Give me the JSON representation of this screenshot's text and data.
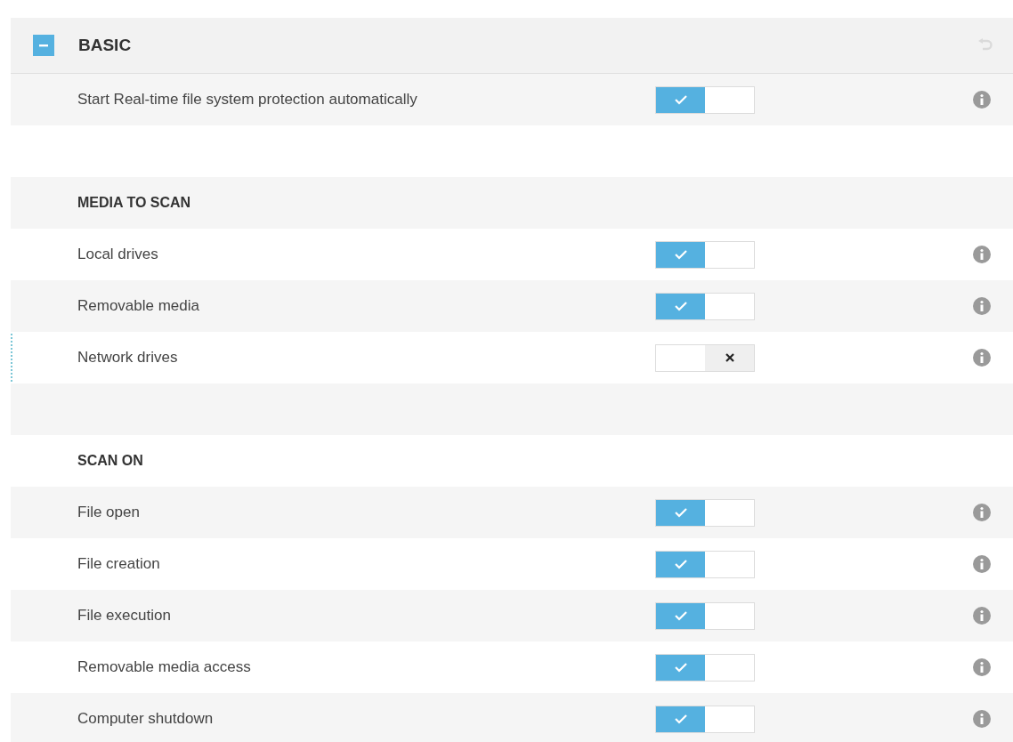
{
  "section": {
    "title": "BASIC",
    "expanded": true
  },
  "rows": [
    {
      "kind": "toggle",
      "label": "Start Real-time file system protection automatically",
      "on": true,
      "focused": false
    },
    {
      "kind": "gap"
    },
    {
      "kind": "heading",
      "label": "MEDIA TO SCAN"
    },
    {
      "kind": "toggle",
      "label": "Local drives",
      "on": true,
      "focused": false
    },
    {
      "kind": "toggle",
      "label": "Removable media",
      "on": true,
      "focused": false
    },
    {
      "kind": "toggle",
      "label": "Network drives",
      "on": false,
      "focused": true
    },
    {
      "kind": "gap"
    },
    {
      "kind": "heading",
      "label": "SCAN ON"
    },
    {
      "kind": "toggle",
      "label": "File open",
      "on": true,
      "focused": false
    },
    {
      "kind": "toggle",
      "label": "File creation",
      "on": true,
      "focused": false
    },
    {
      "kind": "toggle",
      "label": "File execution",
      "on": true,
      "focused": false
    },
    {
      "kind": "toggle",
      "label": "Removable media access",
      "on": true,
      "focused": false
    },
    {
      "kind": "toggle",
      "label": "Computer shutdown",
      "on": true,
      "focused": false
    }
  ]
}
